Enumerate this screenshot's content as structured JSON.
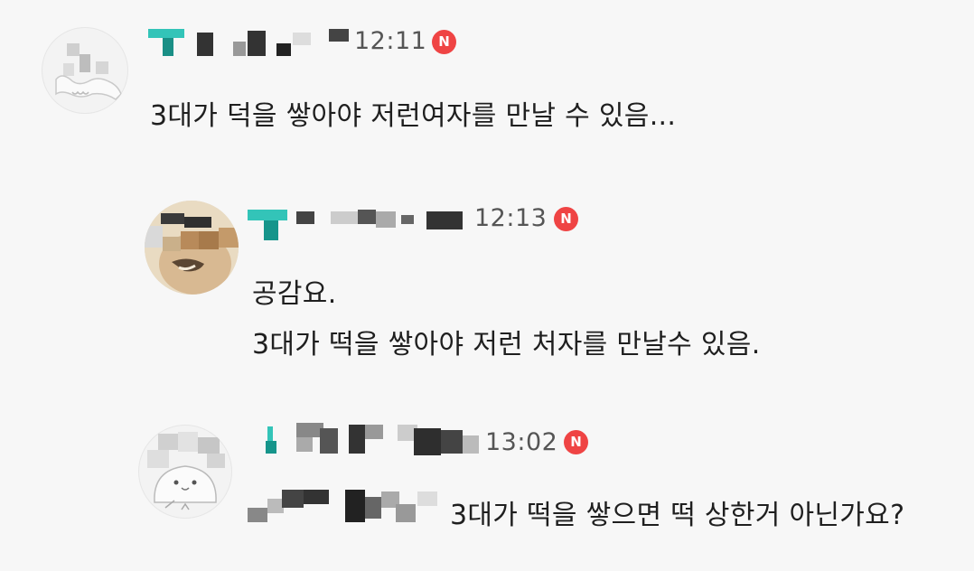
{
  "comments": [
    {
      "time": "12:11",
      "badge": "N",
      "lines": [
        "3대가 덕을 쌓아야 저런여자를 만날 수 있음..."
      ]
    },
    {
      "time": "12:13",
      "badge": "N",
      "lines": [
        "공감요.",
        "3대가 떡을 쌓아야 저런 처자를 만날수 있음."
      ]
    },
    {
      "time": "13:02",
      "badge": "N",
      "lines": [
        "3대가 떡을 쌓으면 떡 상한거 아닌가요?"
      ]
    }
  ],
  "colors": {
    "background": "#f7f7f7",
    "badge": "#ef4444",
    "nickname_accent": "#1fb5a8",
    "text": "#1f1f1f",
    "time": "#555555"
  },
  "icons": [
    "new-badge-icon",
    "dog-avatar-icon",
    "bunny-avatar-icon"
  ]
}
